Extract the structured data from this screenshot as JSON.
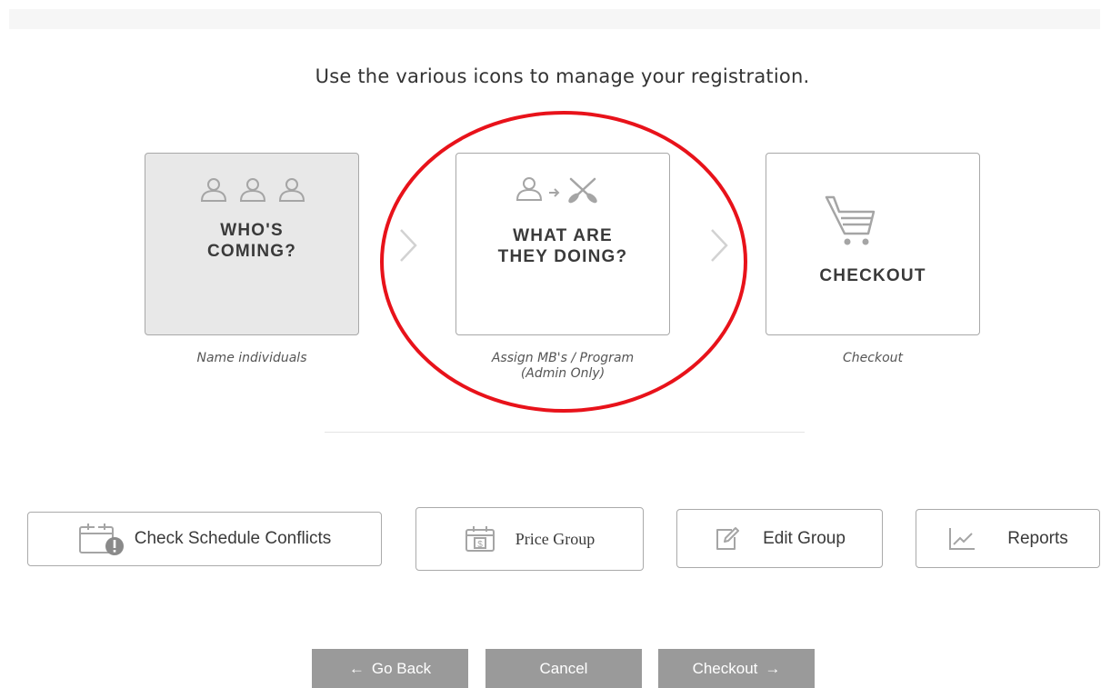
{
  "instructions": "Use the various icons to manage your registration.",
  "steps": [
    {
      "title_line1": "WHO'S",
      "title_line2": "COMING?",
      "caption": "Name individuals",
      "icon": "people-group-icon",
      "state": "active"
    },
    {
      "title_line1": "WHAT ARE",
      "title_line2": "THEY DOING?",
      "caption_line1": "Assign MB's / Program",
      "caption_line2": "(Admin Only)",
      "icon": "person-to-paddles-icon"
    },
    {
      "title": "CHECKOUT",
      "caption": "Checkout",
      "icon": "shopping-cart-icon"
    }
  ],
  "tools": {
    "schedule": "Check Schedule Conflicts",
    "price": "Price Group",
    "edit": "Edit Group",
    "reports": "Reports"
  },
  "nav": {
    "back": "Go Back",
    "cancel": "Cancel",
    "checkout": "Checkout"
  },
  "colors": {
    "highlight_circle": "#e8121a",
    "active_step_bg": "#e8e8e8",
    "nav_button_bg": "#9a9a9a",
    "icon_gray": "#a5a5a5"
  }
}
